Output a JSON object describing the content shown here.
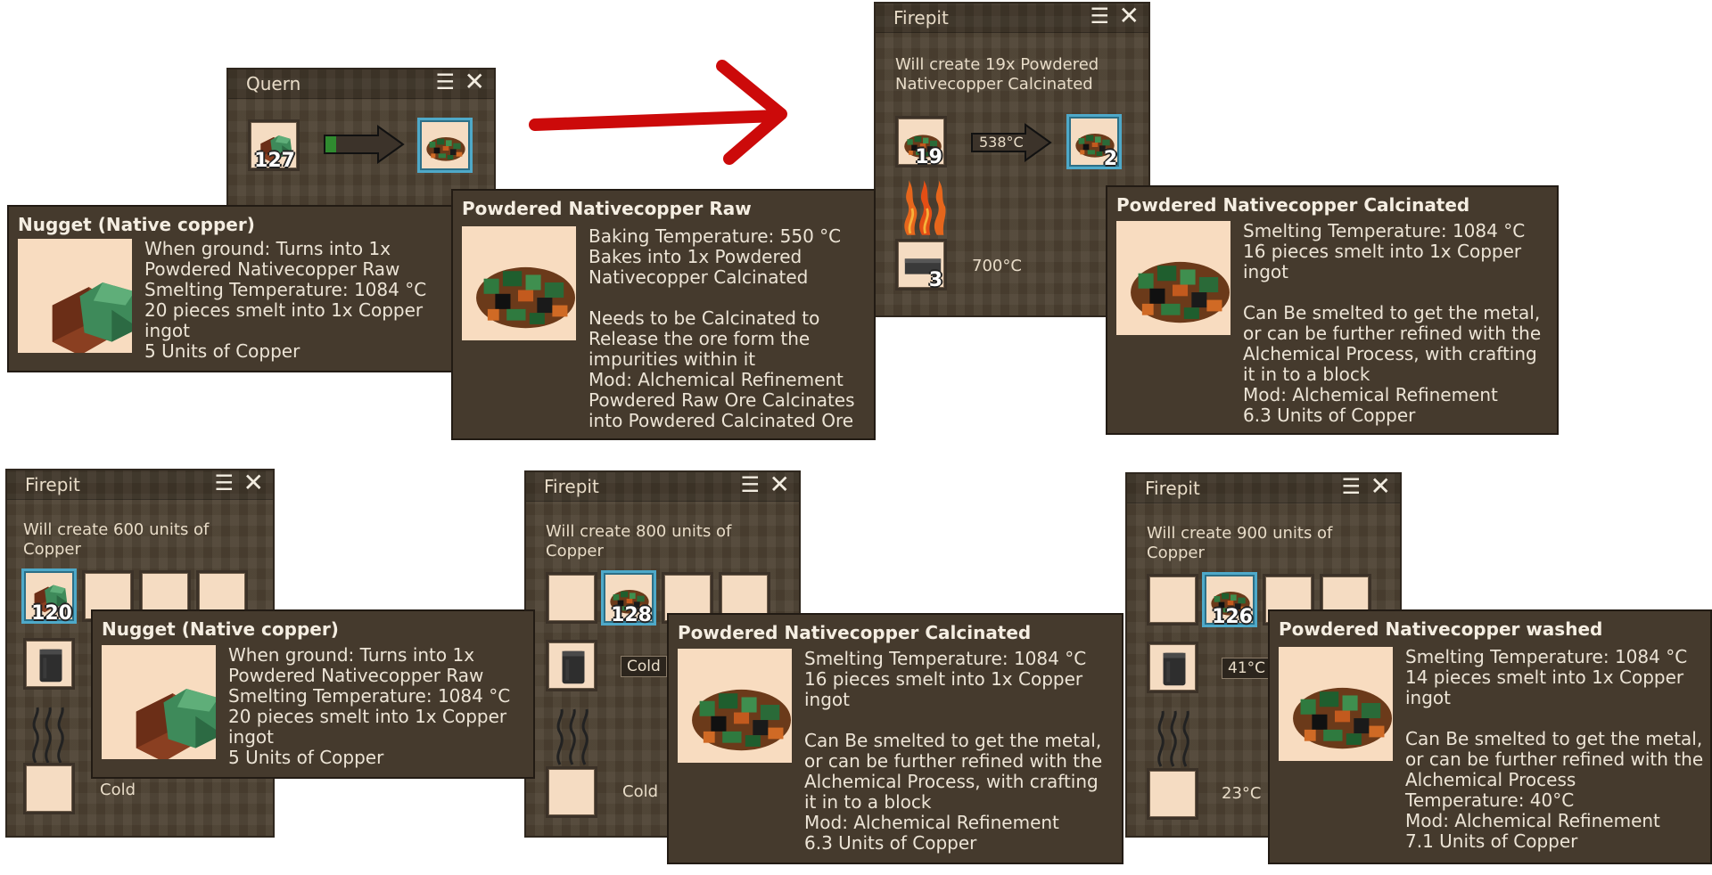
{
  "quern": {
    "title": "Quern",
    "input_count": "127"
  },
  "firepit_top": {
    "title": "Firepit",
    "status": [
      "Will create 19x Powdered",
      "Nativecopper Calcinated"
    ],
    "input_count": "19",
    "output_count": "2",
    "temp": "538°C",
    "fuel_count": "3",
    "fuel_temp": "700°C"
  },
  "firepit_1": {
    "title": "Firepit",
    "status": [
      "Will create 600 units of",
      "Copper"
    ],
    "slot_count": "120",
    "fuel_temp": "Cold"
  },
  "firepit_2": {
    "title": "Firepit",
    "status": [
      "Will create 800 units of",
      "Copper"
    ],
    "slot_count": "128",
    "temp": "Cold",
    "fuel_temp": "Cold"
  },
  "firepit_3": {
    "title": "Firepit",
    "status": [
      "Will create 900 units of",
      "Copper"
    ],
    "slot_count": "126",
    "temp": "41°C",
    "fuel_temp": "23°C"
  },
  "tip_nugget": {
    "title": "Nugget (Native copper)",
    "lines": [
      "When ground: Turns into 1x",
      "Powdered Nativecopper Raw",
      "Smelting Temperature: 1084 °C",
      "20 pieces smelt into 1x Copper",
      "ingot",
      "5 Units of Copper"
    ]
  },
  "tip_raw": {
    "title": "Powdered Nativecopper Raw",
    "lines": [
      "Baking Temperature: 550 °C",
      "Bakes into 1x Powdered",
      "Nativecopper Calcinated",
      "",
      "Needs to be Calcinated to",
      "Release the ore form the",
      "impurities within it",
      "Mod: Alchemical Refinement",
      "Powdered Raw Ore Calcinates",
      "into Powdered Calcinated Ore"
    ]
  },
  "tip_calc_top": {
    "title": "Powdered Nativecopper Calcinated",
    "lines": [
      "Smelting Temperature: 1084 °C",
      "16 pieces smelt into 1x Copper",
      "ingot",
      "",
      "Can Be smelted to get the metal,",
      "or can be further refined with the",
      "Alchemical Process, with crafting",
      "it in to a block",
      "Mod: Alchemical Refinement",
      "6.3 Units of Copper"
    ]
  },
  "tip_nugget_2": {
    "title": "Nugget (Native copper)",
    "lines": [
      "When ground: Turns into 1x",
      "Powdered Nativecopper Raw",
      "Smelting Temperature: 1084 °C",
      "20 pieces smelt into 1x Copper",
      "ingot",
      "5 Units of Copper"
    ]
  },
  "tip_calc_bottom": {
    "title": "Powdered Nativecopper Calcinated",
    "lines": [
      "Smelting Temperature: 1084 °C",
      "16 pieces smelt into 1x Copper",
      "ingot",
      "",
      "Can Be smelted to get the metal,",
      "or can be further refined with the",
      "Alchemical Process, with crafting",
      "it in to a block",
      "Mod: Alchemical Refinement",
      "6.3 Units of Copper"
    ]
  },
  "tip_washed": {
    "title": "Powdered Nativecopper washed",
    "lines": [
      "Smelting Temperature: 1084 °C",
      "14 pieces smelt into 1x Copper",
      "ingot",
      "",
      "Can Be smelted to get the metal,",
      "or can be further refined with the",
      "Alchemical Process",
      "Temperature: 40°C",
      "Mod: Alchemical Refinement",
      "7.1 Units of Copper"
    ]
  },
  "icons": {
    "nugget": "copper-nugget-icon",
    "powder": "copper-powder-icon",
    "fuel": "charcoal-icon",
    "flame": "fire-icon",
    "smoke": "smoke-icon",
    "arrow": "progress-arrow-icon"
  },
  "colors": {
    "arrow_red": "#cc0a0a",
    "selected_slot": "#4ea9c9",
    "panel": "#4f4334"
  }
}
